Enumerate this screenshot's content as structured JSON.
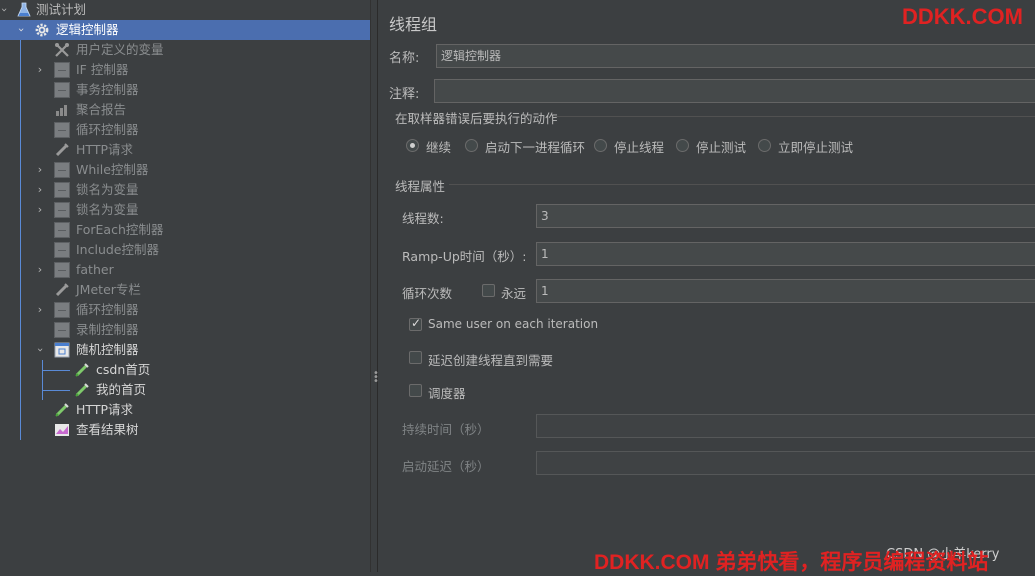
{
  "tree": {
    "items": [
      {
        "label": "测试计划",
        "icon": "flask-icon",
        "chevron": "down"
      },
      {
        "label": "逻辑控制器",
        "icon": "gear-icon",
        "chevron": "down",
        "selected": true
      },
      {
        "label": "用户定义的变量",
        "icon": "wrench-icon",
        "disabled": true
      },
      {
        "label": "IF 控制器",
        "icon": "controller-icon",
        "chevron": "right",
        "disabled": true
      },
      {
        "label": "事务控制器",
        "icon": "controller-icon",
        "disabled": true
      },
      {
        "label": "聚合报告",
        "icon": "chart-icon",
        "disabled": true
      },
      {
        "label": "循环控制器",
        "icon": "controller-icon",
        "disabled": true
      },
      {
        "label": "HTTP请求",
        "icon": "pipette-icon",
        "disabled": true
      },
      {
        "label": "While控制器",
        "icon": "controller-icon",
        "chevron": "right",
        "disabled": true
      },
      {
        "label": "锁名为变量",
        "icon": "controller-icon",
        "chevron": "right",
        "disabled": true
      },
      {
        "label": "锁名为变量",
        "icon": "controller-icon",
        "chevron": "right",
        "disabled": true
      },
      {
        "label": "ForEach控制器",
        "icon": "controller-icon",
        "disabled": true
      },
      {
        "label": "Include控制器",
        "icon": "controller-icon",
        "disabled": true
      },
      {
        "label": "father",
        "icon": "controller-icon",
        "chevron": "right",
        "disabled": true
      },
      {
        "label": "JMeter专栏",
        "icon": "pipette-icon",
        "disabled": true
      },
      {
        "label": "循环控制器",
        "icon": "controller-icon",
        "chevron": "right",
        "disabled": true
      },
      {
        "label": "录制控制器",
        "icon": "controller-icon",
        "disabled": true
      },
      {
        "label": "随机控制器",
        "icon": "random-controller-icon",
        "chevron": "down"
      },
      {
        "label": "csdn首页",
        "icon": "pipette-icon"
      },
      {
        "label": "我的首页",
        "icon": "pipette-icon"
      },
      {
        "label": "HTTP请求",
        "icon": "pipette-icon"
      },
      {
        "label": "查看结果树",
        "icon": "result-tree-icon"
      }
    ]
  },
  "panel": {
    "title": "线程组",
    "name_label": "名称:",
    "name_value": "逻辑控制器",
    "comment_label": "注释:",
    "comment_value": "",
    "error_section": "在取样器错误后要执行的动作",
    "error_options": [
      {
        "label": "继续",
        "checked": true
      },
      {
        "label": "启动下一进程循环",
        "checked": false
      },
      {
        "label": "停止线程",
        "checked": false
      },
      {
        "label": "停止测试",
        "checked": false
      },
      {
        "label": "立即停止测试",
        "checked": false
      }
    ],
    "thread_section": "线程属性",
    "threads_label": "线程数:",
    "threads_value": "3",
    "rampup_label": "Ramp-Up时间（秒）:",
    "rampup_value": "1",
    "loop_label": "循环次数",
    "forever_label": "永远",
    "forever_checked": false,
    "loop_value": "1",
    "same_user_label": "Same user on each iteration",
    "same_user_checked": true,
    "delay_label": "延迟创建线程直到需要",
    "delay_checked": false,
    "scheduler_label": "调度器",
    "scheduler_checked": false,
    "duration_label": "持续时间（秒）",
    "duration_value": "",
    "startup_delay_label": "启动延迟（秒）",
    "startup_delay_value": ""
  },
  "watermarks": {
    "top": "DDKK.COM",
    "bottom": "DDKK.COM 弟弟快看，程序员编程资料站",
    "csdn": "CSDN @小羊kerry"
  },
  "colors": {
    "background": "#3c3f41",
    "selection": "#4b6eaf",
    "watermark": "#e02222",
    "tree_line": "#5a8ad6"
  }
}
